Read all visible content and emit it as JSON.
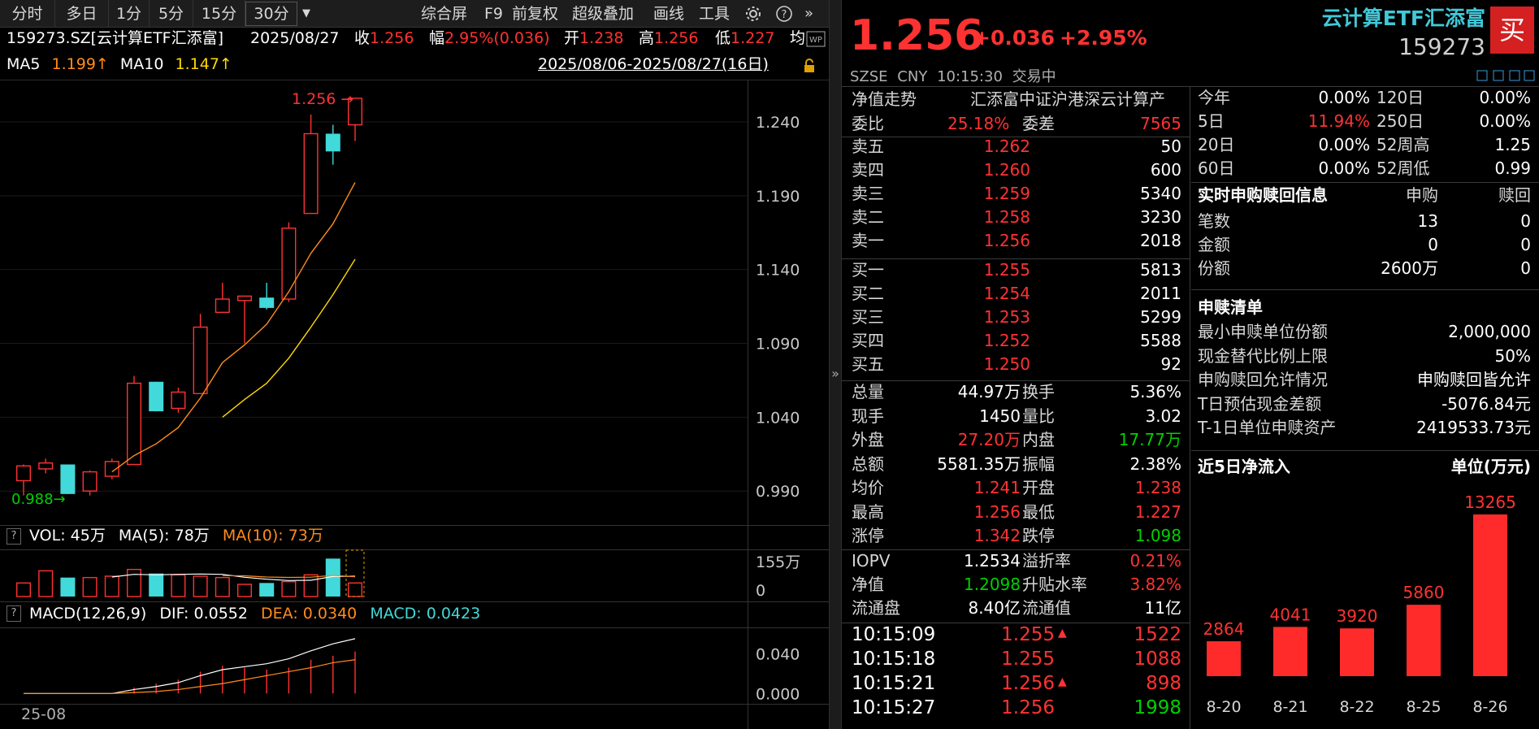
{
  "toolbar": {
    "items": [
      "分时",
      "多日",
      "1分",
      "5分",
      "15分",
      "30分"
    ],
    "items_right": [
      "综合屏",
      "F9",
      "前复权",
      "超级叠加",
      "画线",
      "工具"
    ]
  },
  "info": {
    "code_name": "159273.SZ[云计算ETF汇添富]",
    "date": "2025/08/27",
    "close_label": "收",
    "close": "1.256",
    "change_label": "幅",
    "change": "2.95%(0.036)",
    "open_label": "开",
    "open": "1.238",
    "high_label": "高",
    "high": "1.256",
    "low_label": "低",
    "low": "1.227",
    "avg_label": "均"
  },
  "ma": {
    "ma5_label": "MA5",
    "ma5": "1.199↑",
    "ma10_label": "MA10",
    "ma10": "1.147↑",
    "range": "2025/08/06-2025/08/27(16日)"
  },
  "kline": {
    "high_marker": "1.256",
    "low_marker": "0.988",
    "yticks": [
      "1.240",
      "1.190",
      "1.140",
      "1.090",
      "1.040",
      "0.990"
    ],
    "x_start_label": "25-08"
  },
  "chart_data": {
    "type": "candlestick",
    "dates": [
      "08-06",
      "08-07",
      "08-08",
      "08-11",
      "08-12",
      "08-13",
      "08-14",
      "08-15",
      "08-18",
      "08-19",
      "08-20",
      "08-21",
      "08-22",
      "08-25",
      "08-26",
      "08-27"
    ],
    "ohlc": [
      [
        0.997,
        1.008,
        0.987,
        1.007
      ],
      [
        1.005,
        1.012,
        1.002,
        1.009
      ],
      [
        1.008,
        1.008,
        0.988,
        0.988
      ],
      [
        0.99,
        1.004,
        0.987,
        1.003
      ],
      [
        1.0,
        1.012,
        0.998,
        1.01
      ],
      [
        1.008,
        1.068,
        1.008,
        1.063
      ],
      [
        1.064,
        1.064,
        1.044,
        1.044
      ],
      [
        1.046,
        1.06,
        1.043,
        1.057
      ],
      [
        1.056,
        1.11,
        1.056,
        1.101
      ],
      [
        1.111,
        1.131,
        1.111,
        1.12
      ],
      [
        1.119,
        1.122,
        1.09,
        1.122
      ],
      [
        1.121,
        1.131,
        1.113,
        1.114
      ],
      [
        1.12,
        1.172,
        1.118,
        1.168
      ],
      [
        1.178,
        1.245,
        1.178,
        1.232
      ],
      [
        1.232,
        1.238,
        1.211,
        1.22
      ],
      [
        1.238,
        1.256,
        1.227,
        1.256
      ]
    ],
    "ma5": [
      null,
      null,
      null,
      null,
      1.003,
      1.014,
      1.022,
      1.033,
      1.053,
      1.077,
      1.089,
      1.103,
      1.125,
      1.151,
      1.171,
      1.199
    ],
    "ma10": [
      null,
      null,
      null,
      null,
      null,
      null,
      null,
      null,
      null,
      1.04,
      1.052,
      1.063,
      1.08,
      1.101,
      1.123,
      1.147
    ],
    "volume_wan": [
      10,
      19,
      14,
      14,
      15,
      20,
      17,
      16,
      15,
      14,
      9,
      10,
      11,
      16,
      28,
      10
    ],
    "volume_ma5": [
      null,
      null,
      null,
      null,
      14.4,
      16.4,
      16.0,
      16.4,
      16.6,
      16.4,
      14.2,
      12.8,
      11.8,
      12.0,
      14.8,
      15.0
    ],
    "volume_ma10": [
      null,
      null,
      null,
      null,
      null,
      null,
      null,
      null,
      null,
      15.4,
      15.3,
      14.4,
      14.1,
      14.3,
      15.6,
      14.6
    ],
    "dif": [
      0.0,
      0.0,
      0.0,
      0.0,
      0.0,
      0.004,
      0.007,
      0.011,
      0.018,
      0.024,
      0.027,
      0.03,
      0.035,
      0.043,
      0.05,
      0.0552
    ],
    "dea": [
      0.0,
      0.0,
      0.0,
      0.0,
      0.0,
      0.001,
      0.002,
      0.004,
      0.007,
      0.01,
      0.014,
      0.018,
      0.022,
      0.026,
      0.031,
      0.034
    ],
    "macd": [
      0.0,
      0.0,
      0.0,
      0.0,
      0.0,
      0.006,
      0.01,
      0.014,
      0.022,
      0.028,
      0.026,
      0.024,
      0.026,
      0.034,
      0.038,
      0.0423
    ]
  },
  "volume": {
    "q": "?",
    "label": "VOL: 45万",
    "ma5": "MA(5): 78万",
    "ma10": "MA(10): 73万",
    "ytop": "155万",
    "ybottom": "0"
  },
  "macd_panel": {
    "q": "?",
    "label": "MACD(12,26,9)",
    "dif": "DIF: 0.0552",
    "dea": "DEA: 0.0340",
    "macd": "MACD: 0.0423",
    "yticks": [
      "0.040",
      "0.000"
    ]
  },
  "quote": {
    "price": "1.256",
    "change": "+0.036",
    "pct": "+2.95%",
    "name": "云计算ETF汇添富",
    "code": "159273",
    "trade_btn": "买",
    "market": "SZSE",
    "currency": "CNY",
    "time": "10:15:30",
    "status": "交易中"
  },
  "net_value": {
    "label": "净值走势",
    "index": "汇添富中证沪港深云计算产"
  },
  "order_ratio": {
    "wb_label": "委比",
    "wb": "25.18%",
    "wc_label": "委差",
    "wc": "7565"
  },
  "asks": [
    {
      "label": "卖五",
      "price": "1.262",
      "vol": "50"
    },
    {
      "label": "卖四",
      "price": "1.260",
      "vol": "600"
    },
    {
      "label": "卖三",
      "price": "1.259",
      "vol": "5340"
    },
    {
      "label": "卖二",
      "price": "1.258",
      "vol": "3230"
    },
    {
      "label": "卖一",
      "price": "1.256",
      "vol": "2018"
    }
  ],
  "bids": [
    {
      "label": "买一",
      "price": "1.255",
      "vol": "5813"
    },
    {
      "label": "买二",
      "price": "1.254",
      "vol": "2011"
    },
    {
      "label": "买三",
      "price": "1.253",
      "vol": "5299"
    },
    {
      "label": "买四",
      "price": "1.252",
      "vol": "5588"
    },
    {
      "label": "买五",
      "price": "1.250",
      "vol": "92"
    }
  ],
  "stats": [
    {
      "l1": "总量",
      "v1": "44.97万",
      "c1": "white",
      "l2": "换手",
      "v2": "5.36%",
      "c2": "white"
    },
    {
      "l1": "现手",
      "v1": "1450",
      "c1": "white",
      "l2": "量比",
      "v2": "3.02",
      "c2": "white"
    },
    {
      "l1": "外盘",
      "v1": "27.20万",
      "c1": "red",
      "l2": "内盘",
      "v2": "17.77万",
      "c2": "green"
    },
    {
      "l1": "总额",
      "v1": "5581.35万",
      "c1": "white",
      "l2": "振幅",
      "v2": "2.38%",
      "c2": "white"
    },
    {
      "l1": "均价",
      "v1": "1.241",
      "c1": "red",
      "l2": "开盘",
      "v2": "1.238",
      "c2": "red"
    },
    {
      "l1": "最高",
      "v1": "1.256",
      "c1": "red",
      "l2": "最低",
      "v2": "1.227",
      "c2": "red"
    },
    {
      "l1": "涨停",
      "v1": "1.342",
      "c1": "red",
      "l2": "跌停",
      "v2": "1.098",
      "c2": "green"
    }
  ],
  "iopv": [
    {
      "l1": "IOPV",
      "v1": "1.2534",
      "c1": "white",
      "l2": "溢折率",
      "v2": "0.21%",
      "c2": "red"
    },
    {
      "l1": "净值",
      "v1": "1.2098",
      "c1": "green",
      "l2": "升贴水率",
      "v2": "3.82%",
      "c2": "red"
    },
    {
      "l1": "流通盘",
      "v1": "8.40亿",
      "c1": "white",
      "l2": "流通值",
      "v2": "11亿",
      "c2": "white"
    }
  ],
  "ticks": [
    {
      "time": "10:15:09",
      "price": "1.255",
      "arrow": "🠅",
      "vol": "1522",
      "vc": "red"
    },
    {
      "time": "10:15:18",
      "price": "1.255",
      "arrow": "",
      "vol": "1088",
      "vc": "red"
    },
    {
      "time": "10:15:21",
      "price": "1.256",
      "arrow": "🠅",
      "vol": "898",
      "vc": "red"
    },
    {
      "time": "10:15:27",
      "price": "1.256",
      "arrow": "",
      "vol": "1998",
      "vc": "green"
    }
  ],
  "periods": [
    {
      "l1": "今年",
      "v1": "0.00%",
      "c1": "white",
      "l2": "120日",
      "v2": "0.00%"
    },
    {
      "l1": "5日",
      "v1": "11.94%",
      "c1": "red",
      "l2": "250日",
      "v2": "0.00%"
    },
    {
      "l1": "20日",
      "v1": "0.00%",
      "c1": "white",
      "l2": "52周高",
      "v2": "1.25"
    },
    {
      "l1": "60日",
      "v1": "0.00%",
      "c1": "white",
      "l2": "52周低",
      "v2": "0.99"
    }
  ],
  "subred": {
    "title": "实时申购赎回信息",
    "h1": "申购",
    "h2": "赎回",
    "rows": [
      {
        "label": "笔数",
        "v1": "13",
        "v2": "0"
      },
      {
        "label": "金额",
        "v1": "0",
        "v2": "0"
      },
      {
        "label": "份额",
        "v1": "2600万",
        "v2": "0"
      }
    ]
  },
  "list": {
    "title": "申赎清单",
    "rows": [
      {
        "label": "最小申赎单位份额",
        "value": "2,000,000"
      },
      {
        "label": "现金替代比例上限",
        "value": "50%"
      },
      {
        "label": "申购赎回允许情况",
        "value": "申购赎回皆允许"
      },
      {
        "label": "T日预估现金差额",
        "value": "-5076.84元"
      },
      {
        "label": "T-1日单位申赎资产",
        "value": "2419533.73元"
      }
    ]
  },
  "inflow": {
    "title": "近5日净流入",
    "unit": "单位(万元)",
    "bar_color": "#ff2b2b",
    "dates": [
      "8-20",
      "8-21",
      "8-22",
      "8-25",
      "8-26"
    ],
    "values": [
      2864,
      4041,
      3920,
      5860,
      13265
    ],
    "labels": [
      "2864",
      "4041",
      "3920",
      "5860",
      "13265"
    ]
  }
}
